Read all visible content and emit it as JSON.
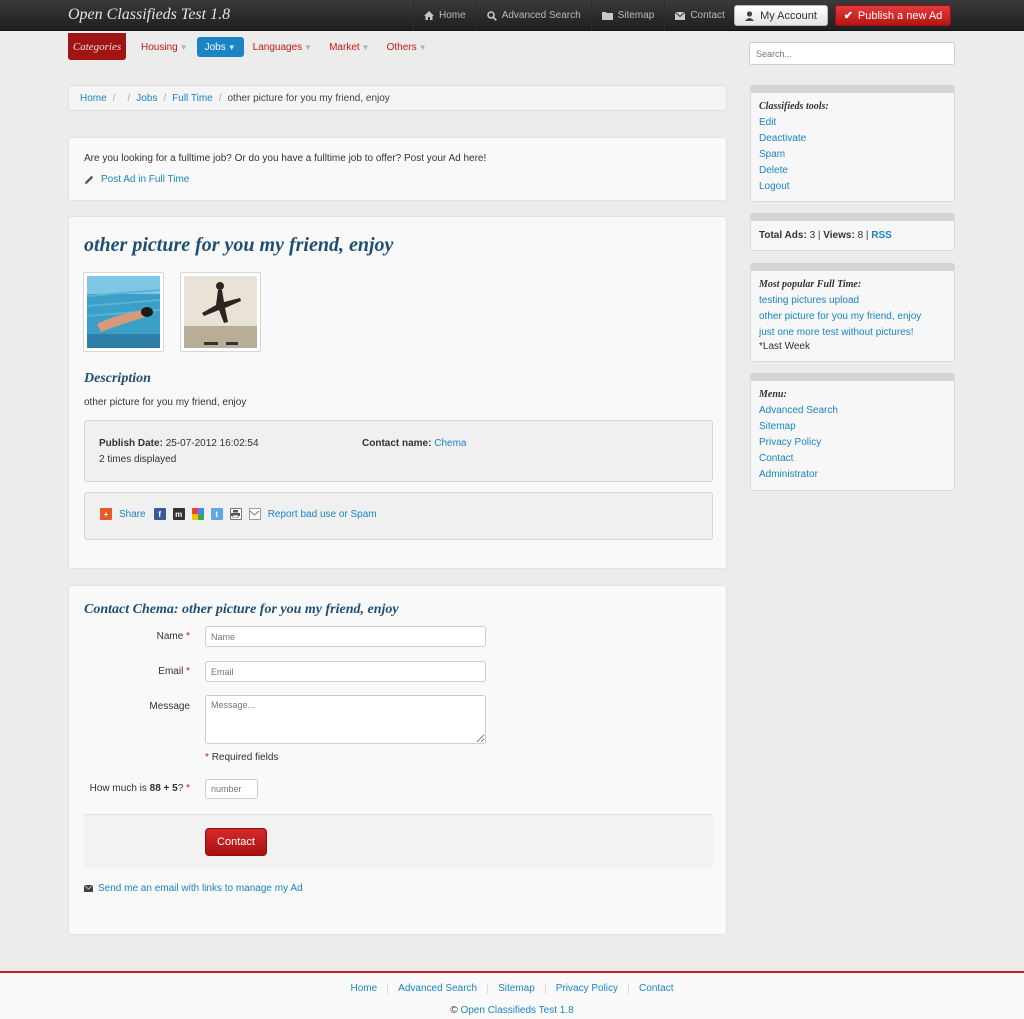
{
  "header": {
    "brand": "Open Classifieds Test 1.8",
    "nav": [
      {
        "label": "Home",
        "icon": "home-icon"
      },
      {
        "label": "Advanced Search",
        "icon": "search-icon"
      },
      {
        "label": "Sitemap",
        "icon": "folder-icon"
      },
      {
        "label": "Contact",
        "icon": "envelope-icon"
      }
    ],
    "account_label": "My Account",
    "publish_label": "Publish a new Ad"
  },
  "categories": {
    "label": "Categories",
    "items": [
      {
        "label": "Housing",
        "active": false
      },
      {
        "label": "Jobs",
        "active": true
      },
      {
        "label": "Languages",
        "active": false
      },
      {
        "label": "Market",
        "active": false
      },
      {
        "label": "Others",
        "active": false
      }
    ]
  },
  "search": {
    "placeholder": "Search..."
  },
  "breadcrumb": {
    "home": "Home",
    "jobs": "Jobs",
    "fulltime": "Full Time",
    "current": "other picture for you my friend, enjoy"
  },
  "intro": {
    "text": "Are you looking for a fulltime job? Or do you have a fulltime job to offer? Post your Ad here!",
    "post_link": "Post Ad in Full Time"
  },
  "ad": {
    "title": "other picture for you my friend, enjoy",
    "description_heading": "Description",
    "description": "other picture for you my friend, enjoy",
    "publish_label": "Publish Date:",
    "publish_date": "25-07-2012 16:02:54",
    "displayed": "2 times displayed",
    "contact_label": "Contact name:",
    "contact_name": "Chema",
    "share_label": "Share",
    "report_link": "Report bad use or Spam"
  },
  "contact_form": {
    "heading": "Contact Chema: other picture for you my friend, enjoy",
    "name_label": "Name",
    "name_placeholder": "Name",
    "email_label": "Email",
    "email_placeholder": "Email",
    "message_label": "Message",
    "message_placeholder": "Message...",
    "required_note": "Required fields",
    "captcha_prefix": "How much is ",
    "captcha_expr": "88 + 5",
    "captcha_suffix": "?",
    "captcha_placeholder": "number",
    "submit_label": "Contact",
    "manage_link": "Send me an email with links to manage my Ad"
  },
  "sidebar": {
    "tools_heading": "Classifieds tools:",
    "tools": [
      "Edit",
      "Deactivate",
      "Spam",
      "Delete",
      "Logout"
    ],
    "stats_total_label": "Total Ads:",
    "stats_total": "3",
    "stats_views_label": "Views:",
    "stats_views": "8",
    "stats_rss": "RSS",
    "popular_heading": "Most popular Full Time:",
    "popular": [
      "testing pictures upload",
      "other picture for you my friend, enjoy",
      "just one more test without pictures!"
    ],
    "popular_note": "*Last Week",
    "menu_heading": "Menu:",
    "menu": [
      "Advanced Search",
      "Sitemap",
      "Privacy Policy",
      "Contact",
      "Administrator"
    ]
  },
  "footer": {
    "links": [
      "Home",
      "Advanced Search",
      "Sitemap",
      "Privacy Policy",
      "Contact"
    ],
    "copyright_symbol": "©",
    "copyright_link": "Open Classifieds Test 1.8"
  },
  "colors": {
    "accent": "#1a84c4",
    "brand_red": "#c21a1a",
    "navbar": "#2b2b2b"
  }
}
